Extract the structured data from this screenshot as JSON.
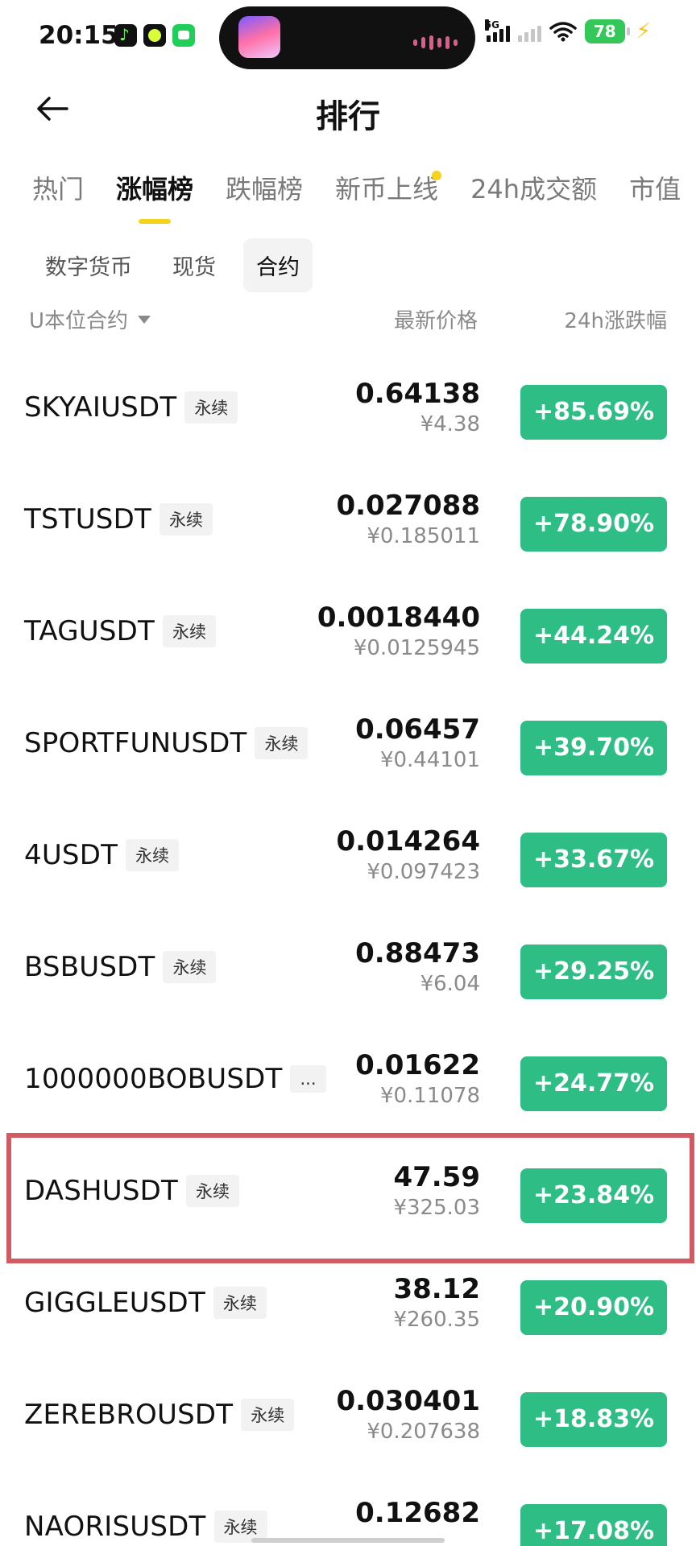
{
  "status_bar": {
    "time": "20:15",
    "network": "5G",
    "battery": "78"
  },
  "header": {
    "title": "排行"
  },
  "main_tabs": [
    {
      "label": "热门"
    },
    {
      "label": "涨幅榜"
    },
    {
      "label": "跌幅榜"
    },
    {
      "label": "新币上线"
    },
    {
      "label": "24h成交额"
    },
    {
      "label": "市值"
    }
  ],
  "sub_tabs": [
    {
      "label": "数字货币"
    },
    {
      "label": "现货"
    },
    {
      "label": "合约"
    }
  ],
  "columns": {
    "name": "U本位合约",
    "price": "最新价格",
    "change": "24h涨跌幅"
  },
  "rows": [
    {
      "symbol": "SKYAIUSDT",
      "tag": "永续",
      "price": "0.64138",
      "cny": "¥4.38",
      "change": "+85.69%"
    },
    {
      "symbol": "TSTUSDT",
      "tag": "永续",
      "price": "0.027088",
      "cny": "¥0.185011",
      "change": "+78.90%"
    },
    {
      "symbol": "TAGUSDT",
      "tag": "永续",
      "price": "0.0018440",
      "cny": "¥0.0125945",
      "change": "+44.24%"
    },
    {
      "symbol": "SPORTFUNUSDT",
      "tag": "永续",
      "price": "0.06457",
      "cny": "¥0.44101",
      "change": "+39.70%"
    },
    {
      "symbol": "4USDT",
      "tag": "永续",
      "price": "0.014264",
      "cny": "¥0.097423",
      "change": "+33.67%"
    },
    {
      "symbol": "BSBUSDT",
      "tag": "永续",
      "price": "0.88473",
      "cny": "¥6.04",
      "change": "+29.25%"
    },
    {
      "symbol": "1000000BOBUSDT",
      "tag": "...",
      "price": "0.01622",
      "cny": "¥0.11078",
      "change": "+24.77%"
    },
    {
      "symbol": "DASHUSDT",
      "tag": "永续",
      "price": "47.59",
      "cny": "¥325.03",
      "change": "+23.84%"
    },
    {
      "symbol": "GIGGLEUSDT",
      "tag": "永续",
      "price": "38.12",
      "cny": "¥260.35",
      "change": "+20.90%"
    },
    {
      "symbol": "ZEREBROUSDT",
      "tag": "永续",
      "price": "0.030401",
      "cny": "¥0.207638",
      "change": "+18.83%"
    },
    {
      "symbol": "NAORISUSDT",
      "tag": "永续",
      "price": "0.12682",
      "cny": "",
      "change": "+17.08%"
    }
  ],
  "colors": {
    "accent": "#f5d31a",
    "gain": "#2ebd85",
    "highlight_border": "#d15a63"
  }
}
